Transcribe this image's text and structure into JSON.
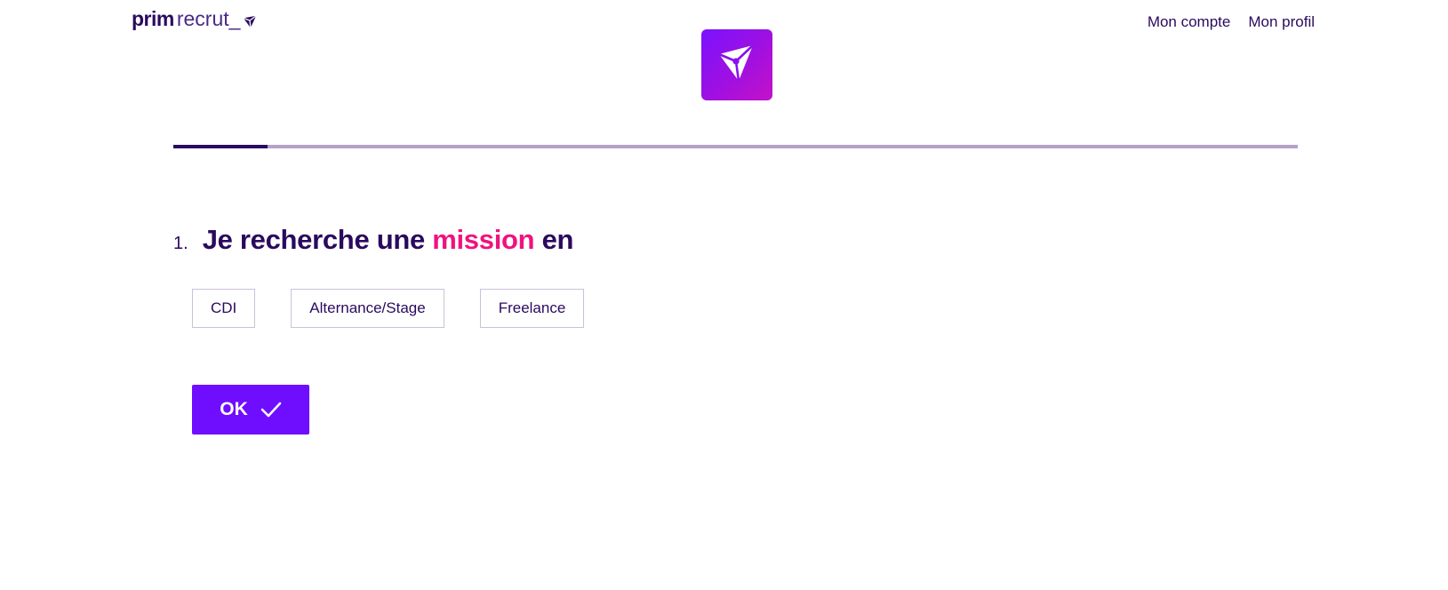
{
  "brand": {
    "name_bold": "prim",
    "name_light": "recrut_",
    "accent_color": "#6f0dff",
    "highlight_color": "#f0127e",
    "text_color": "#2a0a5e",
    "logo_icon": "diamond-icon"
  },
  "nav": {
    "items": [
      {
        "label": "Mon compte"
      },
      {
        "label": "Mon profil"
      }
    ]
  },
  "app_badge": {
    "icon": "diamond-icon"
  },
  "progress": {
    "value_percent": 8.4
  },
  "question": {
    "number": "1.",
    "text_before": "Je recherche une ",
    "text_highlight": "mission",
    "text_after": " en"
  },
  "options": [
    {
      "label": "CDI"
    },
    {
      "label": "Alternance/Stage"
    },
    {
      "label": "Freelance"
    }
  ],
  "ok_button": {
    "label": "OK",
    "icon": "checkmark-icon"
  }
}
